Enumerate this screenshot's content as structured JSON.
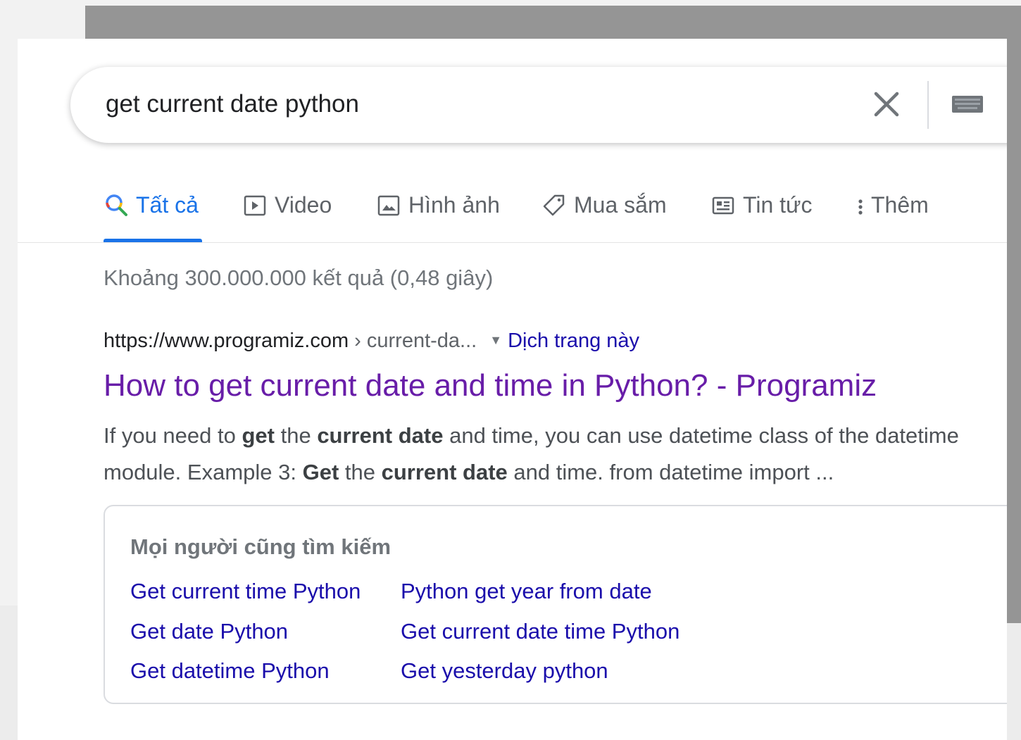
{
  "search": {
    "query": "get current date python"
  },
  "tabs": [
    {
      "label": "Tất cả",
      "icon": "search-icon",
      "active": true
    },
    {
      "label": "Video",
      "icon": "video-icon"
    },
    {
      "label": "Hình ảnh",
      "icon": "image-icon"
    },
    {
      "label": "Mua sắm",
      "icon": "tag-icon"
    },
    {
      "label": "Tin tức",
      "icon": "news-icon"
    },
    {
      "label": "Thêm",
      "icon": "more-vert-icon"
    }
  ],
  "stats": "Khoảng 300.000.000 kết quả (0,48 giây)",
  "result": {
    "domain": "https://www.programiz.com",
    "path": " › current-da...",
    "translate": "Dịch trang này",
    "title": "How to get current date and time in Python? - Programiz",
    "snippet": {
      "l1_a": "If you need to ",
      "l1_b": "get",
      "l1_c": " the ",
      "l1_d": "current date",
      "l1_e": " and time, you can use datetime class of the datetime",
      "l2_a": "module. Example 3: ",
      "l2_b": "Get",
      "l2_c": " the ",
      "l2_d": "current date",
      "l2_e": " and time. from datetime import ..."
    }
  },
  "related": {
    "heading": "Mọi người cũng tìm kiếm",
    "links": [
      "Get current time Python",
      "Python get year from date",
      "Get date Python",
      "Get current date time Python",
      "Get datetime Python",
      "Get yesterday python"
    ]
  },
  "colors": {
    "link_blue": "#1a0dab",
    "visited_purple": "#681da8",
    "tab_active": "#1a73e8"
  }
}
